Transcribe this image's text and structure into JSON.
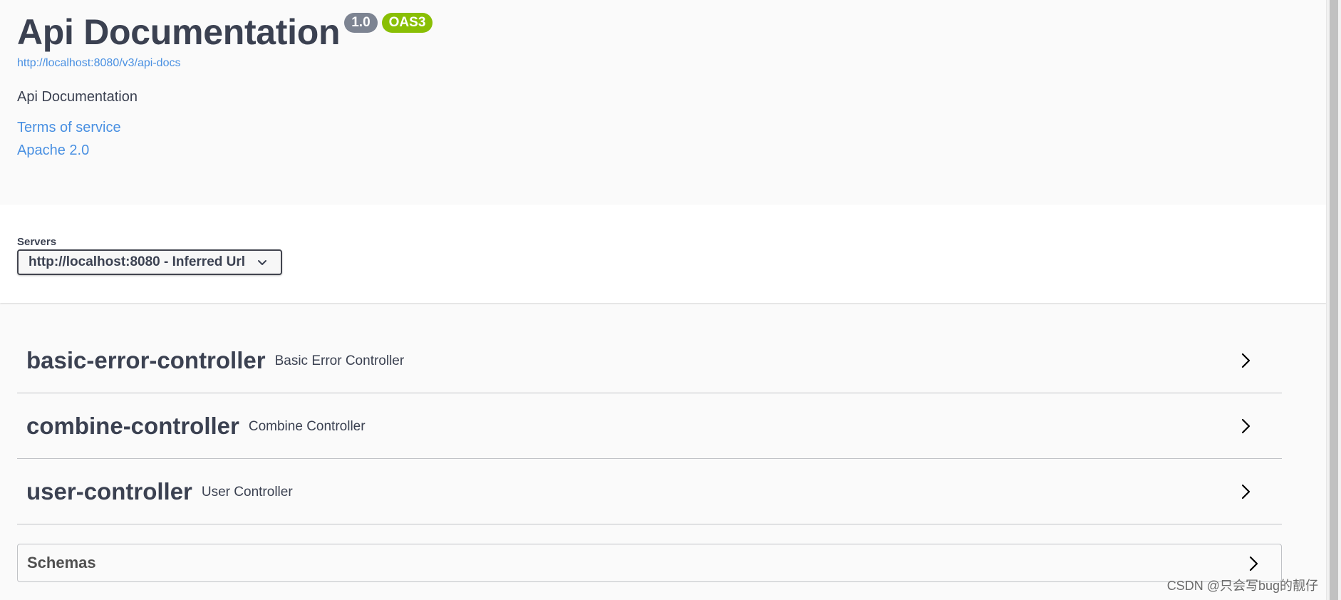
{
  "info": {
    "title": "Api Documentation",
    "version_badge": "1.0",
    "oas_badge": "OAS3",
    "api_docs_url": "http://localhost:8080/v3/api-docs",
    "description": "Api Documentation",
    "terms_of_service": "Terms of service",
    "license": "Apache 2.0"
  },
  "servers": {
    "label": "Servers",
    "selected": "http://localhost:8080 - Inferred Url"
  },
  "tags": [
    {
      "name": "basic-error-controller",
      "description": "Basic Error Controller"
    },
    {
      "name": "combine-controller",
      "description": "Combine Controller"
    },
    {
      "name": "user-controller",
      "description": "User Controller"
    }
  ],
  "schemas": {
    "title": "Schemas"
  },
  "icons": {
    "server_dropdown": "chevron-down-icon",
    "tag_expand": "chevron-right-icon",
    "schemas_expand": "chevron-right-icon"
  },
  "colors": {
    "link": "#4990e2",
    "oas_badge": "#89bf04",
    "version_badge": "#7d8492",
    "text": "#3b4151"
  },
  "watermark": "CSDN @只会写bug的靓仔"
}
